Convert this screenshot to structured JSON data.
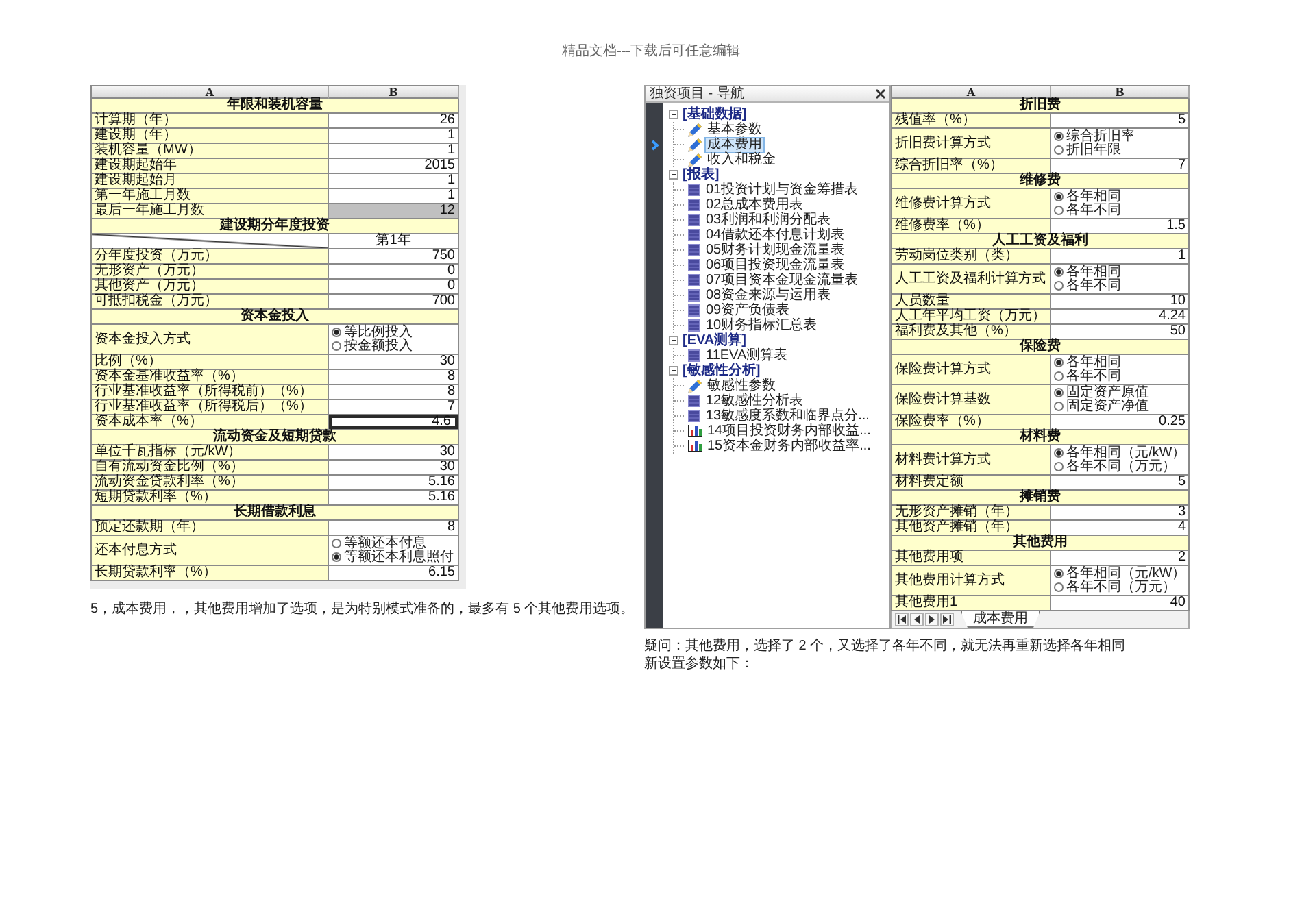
{
  "page_header": "精品文档---下载后可任意编辑",
  "left_sheet": {
    "columns": [
      "A",
      "B"
    ],
    "rows": [
      {
        "kind": "section",
        "label": "年限和装机容量"
      },
      {
        "kind": "value",
        "label": "计算期（年）",
        "value": "26",
        "highlighted": false,
        "active": false
      },
      {
        "kind": "value",
        "label": "建设期（年）",
        "value": "1",
        "highlighted": false,
        "active": false
      },
      {
        "kind": "value",
        "label": "装机容量（MW）",
        "value": "1",
        "highlighted": false,
        "active": false
      },
      {
        "kind": "value",
        "label": "建设期起始年",
        "value": "2015",
        "highlighted": false,
        "active": false
      },
      {
        "kind": "value",
        "label": "建设期起始月",
        "value": "1",
        "highlighted": false,
        "active": false
      },
      {
        "kind": "value",
        "label": "第一年施工月数",
        "value": "1",
        "highlighted": false,
        "active": false
      },
      {
        "kind": "value",
        "label": "最后一年施工月数",
        "value": "12",
        "highlighted": true,
        "active": false
      },
      {
        "kind": "section",
        "label": "建设期分年度投资"
      },
      {
        "kind": "diagonal",
        "column_label": "第1年"
      },
      {
        "kind": "value",
        "label": "分年度投资（万元）",
        "value": "750",
        "highlighted": false,
        "active": false
      },
      {
        "kind": "value",
        "label": "无形资产（万元）",
        "value": "0",
        "highlighted": false,
        "active": false
      },
      {
        "kind": "value",
        "label": "其他资产（万元）",
        "value": "0",
        "highlighted": false,
        "active": false
      },
      {
        "kind": "value",
        "label": "可抵扣税金（万元）",
        "value": "700",
        "highlighted": false,
        "active": false
      },
      {
        "kind": "section",
        "label": "资本金投入"
      },
      {
        "kind": "options",
        "label": "资本金投入方式",
        "options": [
          {
            "label": "等比例投入",
            "checked": true
          },
          {
            "label": "按金额投入",
            "checked": false
          }
        ]
      },
      {
        "kind": "value",
        "label": "比例（%）",
        "value": "30",
        "highlighted": false,
        "active": false
      },
      {
        "kind": "value",
        "label": "资本金基准收益率（%）",
        "value": "8",
        "highlighted": false,
        "active": false
      },
      {
        "kind": "value",
        "label": "行业基准收益率（所得税前）（%）",
        "value": "8",
        "highlighted": false,
        "active": false
      },
      {
        "kind": "value",
        "label": "行业基准收益率（所得税后）（%）",
        "value": "7",
        "highlighted": false,
        "active": false
      },
      {
        "kind": "value",
        "label": "资本成本率（%）",
        "value": "4.6",
        "highlighted": false,
        "active": true
      },
      {
        "kind": "section",
        "label": "流动资金及短期贷款"
      },
      {
        "kind": "value",
        "label": "单位千瓦指标（元/kW）",
        "value": "30",
        "highlighted": false,
        "active": false
      },
      {
        "kind": "value",
        "label": "自有流动资金比例（%）",
        "value": "30",
        "highlighted": false,
        "active": false
      },
      {
        "kind": "value",
        "label": "流动资金贷款利率（%）",
        "value": "5.16",
        "highlighted": false,
        "active": false
      },
      {
        "kind": "value",
        "label": "短期贷款利率（%）",
        "value": "5.16",
        "highlighted": false,
        "active": false
      },
      {
        "kind": "section",
        "label": "长期借款利息"
      },
      {
        "kind": "value",
        "label": "预定还款期（年）",
        "value": "8",
        "highlighted": false,
        "active": false
      },
      {
        "kind": "options",
        "label": "还本付息方式",
        "options": [
          {
            "label": "等额还本付息",
            "checked": false
          },
          {
            "label": "等额还本利息照付",
            "checked": true
          }
        ]
      },
      {
        "kind": "value",
        "label": "长期贷款利率（%）",
        "value": "6.15",
        "highlighted": false,
        "active": false
      }
    ]
  },
  "left_note": "5，成本费用，，其他费用增加了选项，是为特别模式准备的，最多有 5 个其他费用选项。",
  "navigator": {
    "title": "独资项目 - 导航",
    "groups": [
      {
        "label": "[基础数据]",
        "expanded": true,
        "children": [
          {
            "label": "基本参数",
            "kind": "parameter",
            "selected": false
          },
          {
            "label": "成本费用",
            "kind": "parameter",
            "selected": true
          },
          {
            "label": "收入和税金",
            "kind": "parameter",
            "selected": false
          }
        ]
      },
      {
        "label": "[报表]",
        "expanded": true,
        "children": [
          {
            "label": "01投资计划与资金筹措表",
            "kind": "table",
            "selected": false
          },
          {
            "label": "02总成本费用表",
            "kind": "table",
            "selected": false
          },
          {
            "label": "03利润和利润分配表",
            "kind": "table",
            "selected": false
          },
          {
            "label": "04借款还本付息计划表",
            "kind": "table",
            "selected": false
          },
          {
            "label": "05财务计划现金流量表",
            "kind": "table",
            "selected": false
          },
          {
            "label": "06项目投资现金流量表",
            "kind": "table",
            "selected": false
          },
          {
            "label": "07项目资本金现金流量表",
            "kind": "table",
            "selected": false
          },
          {
            "label": "08资金来源与运用表",
            "kind": "table",
            "selected": false
          },
          {
            "label": "09资产负债表",
            "kind": "table",
            "selected": false
          },
          {
            "label": "10财务指标汇总表",
            "kind": "table",
            "selected": false
          }
        ]
      },
      {
        "label": "[EVA测算]",
        "expanded": true,
        "children": [
          {
            "label": "11EVA测算表",
            "kind": "table",
            "selected": false
          }
        ]
      },
      {
        "label": "[敏感性分析]",
        "expanded": true,
        "children": [
          {
            "label": "敏感性参数",
            "kind": "parameter",
            "selected": false
          },
          {
            "label": "12敏感性分析表",
            "kind": "table",
            "selected": false
          },
          {
            "label": "13敏感度系数和临界点分...",
            "kind": "table",
            "selected": false
          },
          {
            "label": "14项目投资财务内部收益...",
            "kind": "chart",
            "selected": false
          },
          {
            "label": "15资本金财务内部收益率...",
            "kind": "chart",
            "selected": false
          }
        ]
      }
    ]
  },
  "right_sheet": {
    "columns": [
      "A",
      "B"
    ],
    "rows": [
      {
        "kind": "section",
        "label": "折旧费"
      },
      {
        "kind": "value",
        "label": "残值率（%）",
        "value": "5"
      },
      {
        "kind": "options",
        "label": "折旧费计算方式",
        "options": [
          {
            "label": "综合折旧率",
            "checked": true
          },
          {
            "label": "折旧年限",
            "checked": false
          }
        ]
      },
      {
        "kind": "value",
        "label": "综合折旧率（%）",
        "value": "7"
      },
      {
        "kind": "section",
        "label": "维修费"
      },
      {
        "kind": "options",
        "label": "维修费计算方式",
        "options": [
          {
            "label": "各年相同",
            "checked": true
          },
          {
            "label": "各年不同",
            "checked": false
          }
        ]
      },
      {
        "kind": "value",
        "label": "维修费率（%）",
        "value": "1.5"
      },
      {
        "kind": "section",
        "label": "人工工资及福利"
      },
      {
        "kind": "value",
        "label": "劳动岗位类别（类）",
        "value": "1"
      },
      {
        "kind": "options",
        "label": "人工工资及福利计算方式",
        "options": [
          {
            "label": "各年相同",
            "checked": true
          },
          {
            "label": "各年不同",
            "checked": false
          }
        ]
      },
      {
        "kind": "value",
        "label": "人员数量",
        "value": "10"
      },
      {
        "kind": "value",
        "label": "人工年平均工资（万元）",
        "value": "4.24"
      },
      {
        "kind": "value",
        "label": "福利费及其他（%）",
        "value": "50"
      },
      {
        "kind": "section",
        "label": "保险费"
      },
      {
        "kind": "options",
        "label": "保险费计算方式",
        "options": [
          {
            "label": "各年相同",
            "checked": true
          },
          {
            "label": "各年不同",
            "checked": false
          }
        ]
      },
      {
        "kind": "options",
        "label": "保险费计算基数",
        "options": [
          {
            "label": "固定资产原值",
            "checked": true
          },
          {
            "label": "固定资产净值",
            "checked": false
          }
        ]
      },
      {
        "kind": "value",
        "label": "保险费率（%）",
        "value": "0.25"
      },
      {
        "kind": "section",
        "label": "材料费"
      },
      {
        "kind": "options",
        "label": "材料费计算方式",
        "options": [
          {
            "label": "各年相同（元/kW）",
            "checked": true
          },
          {
            "label": "各年不同（万元）",
            "checked": false
          }
        ]
      },
      {
        "kind": "value",
        "label": "材料费定额",
        "value": "5"
      },
      {
        "kind": "section",
        "label": "摊销费"
      },
      {
        "kind": "value",
        "label": "无形资产摊销（年）",
        "value": "3"
      },
      {
        "kind": "value",
        "label": "其他资产摊销（年）",
        "value": "4"
      },
      {
        "kind": "section",
        "label": "其他费用"
      },
      {
        "kind": "value",
        "label": "其他费用项",
        "value": "2"
      },
      {
        "kind": "options",
        "label": "其他费用计算方式",
        "options": [
          {
            "label": "各年相同（元/kW）",
            "checked": true
          },
          {
            "label": "各年不同（万元）",
            "checked": false
          }
        ]
      },
      {
        "kind": "value",
        "label": "其他费用1",
        "value": "40"
      }
    ],
    "sheet_tabs": [
      {
        "label": "成本费用",
        "selected": true
      }
    ]
  },
  "question_note": {
    "lines": [
      "疑问：其他费用，选择了 2 个，又选择了各年不同，就无法再重新选择各年相同",
      "新设置参数如下："
    ]
  }
}
